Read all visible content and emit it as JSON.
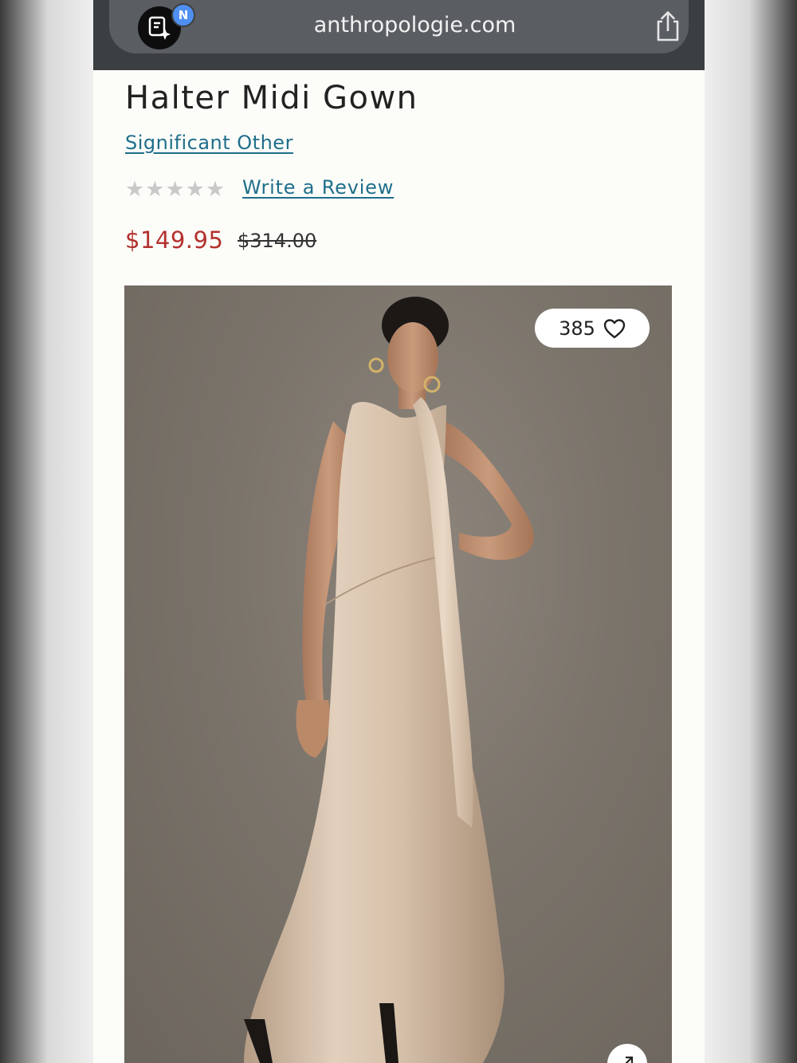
{
  "browser": {
    "url": "anthropologie.com",
    "extension_badge": "N",
    "icons": [
      "notes-sparkle-icon",
      "share-icon"
    ]
  },
  "product": {
    "title_cut_line": "g",
    "title": "Halter Midi Gown",
    "brand": "Significant Other",
    "rating": {
      "stars_filled": 0,
      "stars_total": 5
    },
    "write_review_label": "Write a Review",
    "sale_price": "$149.95",
    "original_price": "$314.00"
  },
  "image": {
    "like_count": "385",
    "icons": [
      "heart-icon",
      "expand-icon"
    ]
  },
  "colors": {
    "link": "#1f6f8b",
    "sale_price": "#b3322e",
    "stars_empty": "#c9c9c9",
    "browser_bar": "#3c3f42",
    "image_background": "#7b746b",
    "gown": "#d7c3ad"
  }
}
